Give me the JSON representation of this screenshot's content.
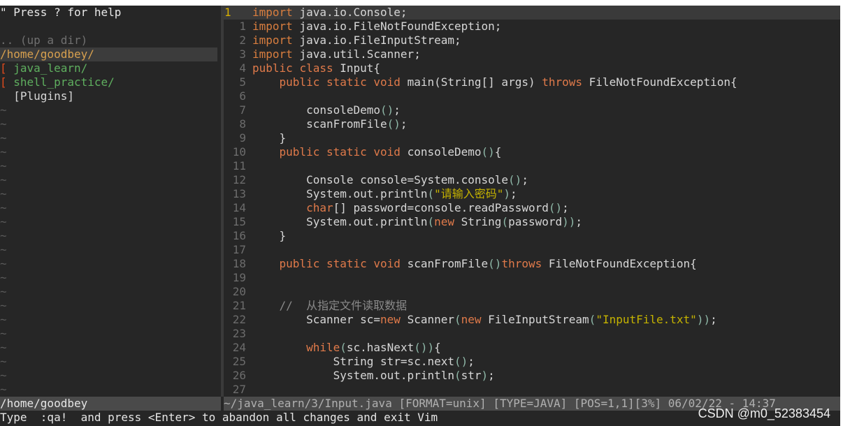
{
  "tree": {
    "help": "\" Press ? for help",
    "blank": "",
    "updir": ".. (up a dir)",
    "current": "/home/goodbey/",
    "entries": [
      {
        "mark": "[",
        "name": " java_learn/"
      },
      {
        "mark": "[",
        "name": " shell_practice/"
      }
    ],
    "plugins": "  [Plugins]",
    "tilde": "~"
  },
  "editor": {
    "current_line_number": "1",
    "lines": [
      {
        "n": "",
        "html": "<span class='kw2'>import</span> java.io.Console;"
      },
      {
        "n": "1",
        "html": "<span class='kw2'>import</span> java.io.FileNotFoundException;"
      },
      {
        "n": "2",
        "html": "<span class='kw2'>import</span> java.io.FileInputStream;"
      },
      {
        "n": "3",
        "html": "<span class='kw2'>import</span> java.util.Scanner;"
      },
      {
        "n": "4",
        "html": "<span class='kw'>public</span> <span class='kw'>class</span> Input{"
      },
      {
        "n": "5",
        "html": "    <span class='kw'>public</span> <span class='kw'>static</span> <span class='kw'>void</span> main(String[] args) <span class='kw'>throws</span> FileNotFoundException{"
      },
      {
        "n": "6",
        "html": ""
      },
      {
        "n": "7",
        "html": "        consoleDemo<span class='paren'>()</span>;"
      },
      {
        "n": "8",
        "html": "        scanFromFile<span class='paren'>()</span>;"
      },
      {
        "n": "9",
        "html": "    }"
      },
      {
        "n": "10",
        "html": "    <span class='kw'>public</span> <span class='kw'>static</span> <span class='kw'>void</span> consoleDemo<span class='paren'>()</span>{"
      },
      {
        "n": "11",
        "html": ""
      },
      {
        "n": "12",
        "html": "        Console console=System.console<span class='paren'>()</span>;"
      },
      {
        "n": "13",
        "html": "        System.out.println<span class='paren'>(</span><span class='str'>\"请输入密码\"</span><span class='paren'>)</span>;"
      },
      {
        "n": "14",
        "html": "        <span class='kw'>char</span>[] password=console.readPassword<span class='paren'>()</span>;"
      },
      {
        "n": "15",
        "html": "        System.out.println<span class='paren'>(</span><span class='kw'>new</span> String<span class='paren'>(</span>password<span class='paren'>))</span>;"
      },
      {
        "n": "16",
        "html": "    }"
      },
      {
        "n": "17",
        "html": ""
      },
      {
        "n": "18",
        "html": "    <span class='kw'>public</span> <span class='kw'>static</span> <span class='kw'>void</span> scanFromFile<span class='paren'>()</span><span class='kw'>throws</span> FileNotFoundException{"
      },
      {
        "n": "19",
        "html": ""
      },
      {
        "n": "20",
        "html": ""
      },
      {
        "n": "21",
        "html": "    <span class='cmt'>//  从指定文件读取数据</span>"
      },
      {
        "n": "22",
        "html": "        Scanner sc=<span class='kw'>new</span> Scanner<span class='paren'>(</span><span class='kw'>new</span> FileInputStream<span class='paren'>(</span><span class='str'>\"InputFile.txt\"</span><span class='paren'>))</span>;"
      },
      {
        "n": "23",
        "html": ""
      },
      {
        "n": "24",
        "html": "        <span class='kw'>while</span><span class='paren'>(</span>sc.hasNext<span class='paren'>()</span><span class='paren'>)</span>{"
      },
      {
        "n": "25",
        "html": "            String str=sc.next<span class='paren'>()</span>;"
      },
      {
        "n": "26",
        "html": "            System.out.println<span class='paren'>(</span>str<span class='paren'>)</span>;"
      },
      {
        "n": "27",
        "html": ""
      }
    ]
  },
  "status": {
    "left": "/home/goodbey",
    "right": "~/java_learn/3/Input.java [FORMAT=unix] [TYPE=JAVA] [POS=1,1][3%] 06/02/22 - 14:37"
  },
  "cmdline": "Type  :qa!  and press <Enter> to abandon all changes and exit Vim",
  "watermark": "CSDN @m0_52383454"
}
